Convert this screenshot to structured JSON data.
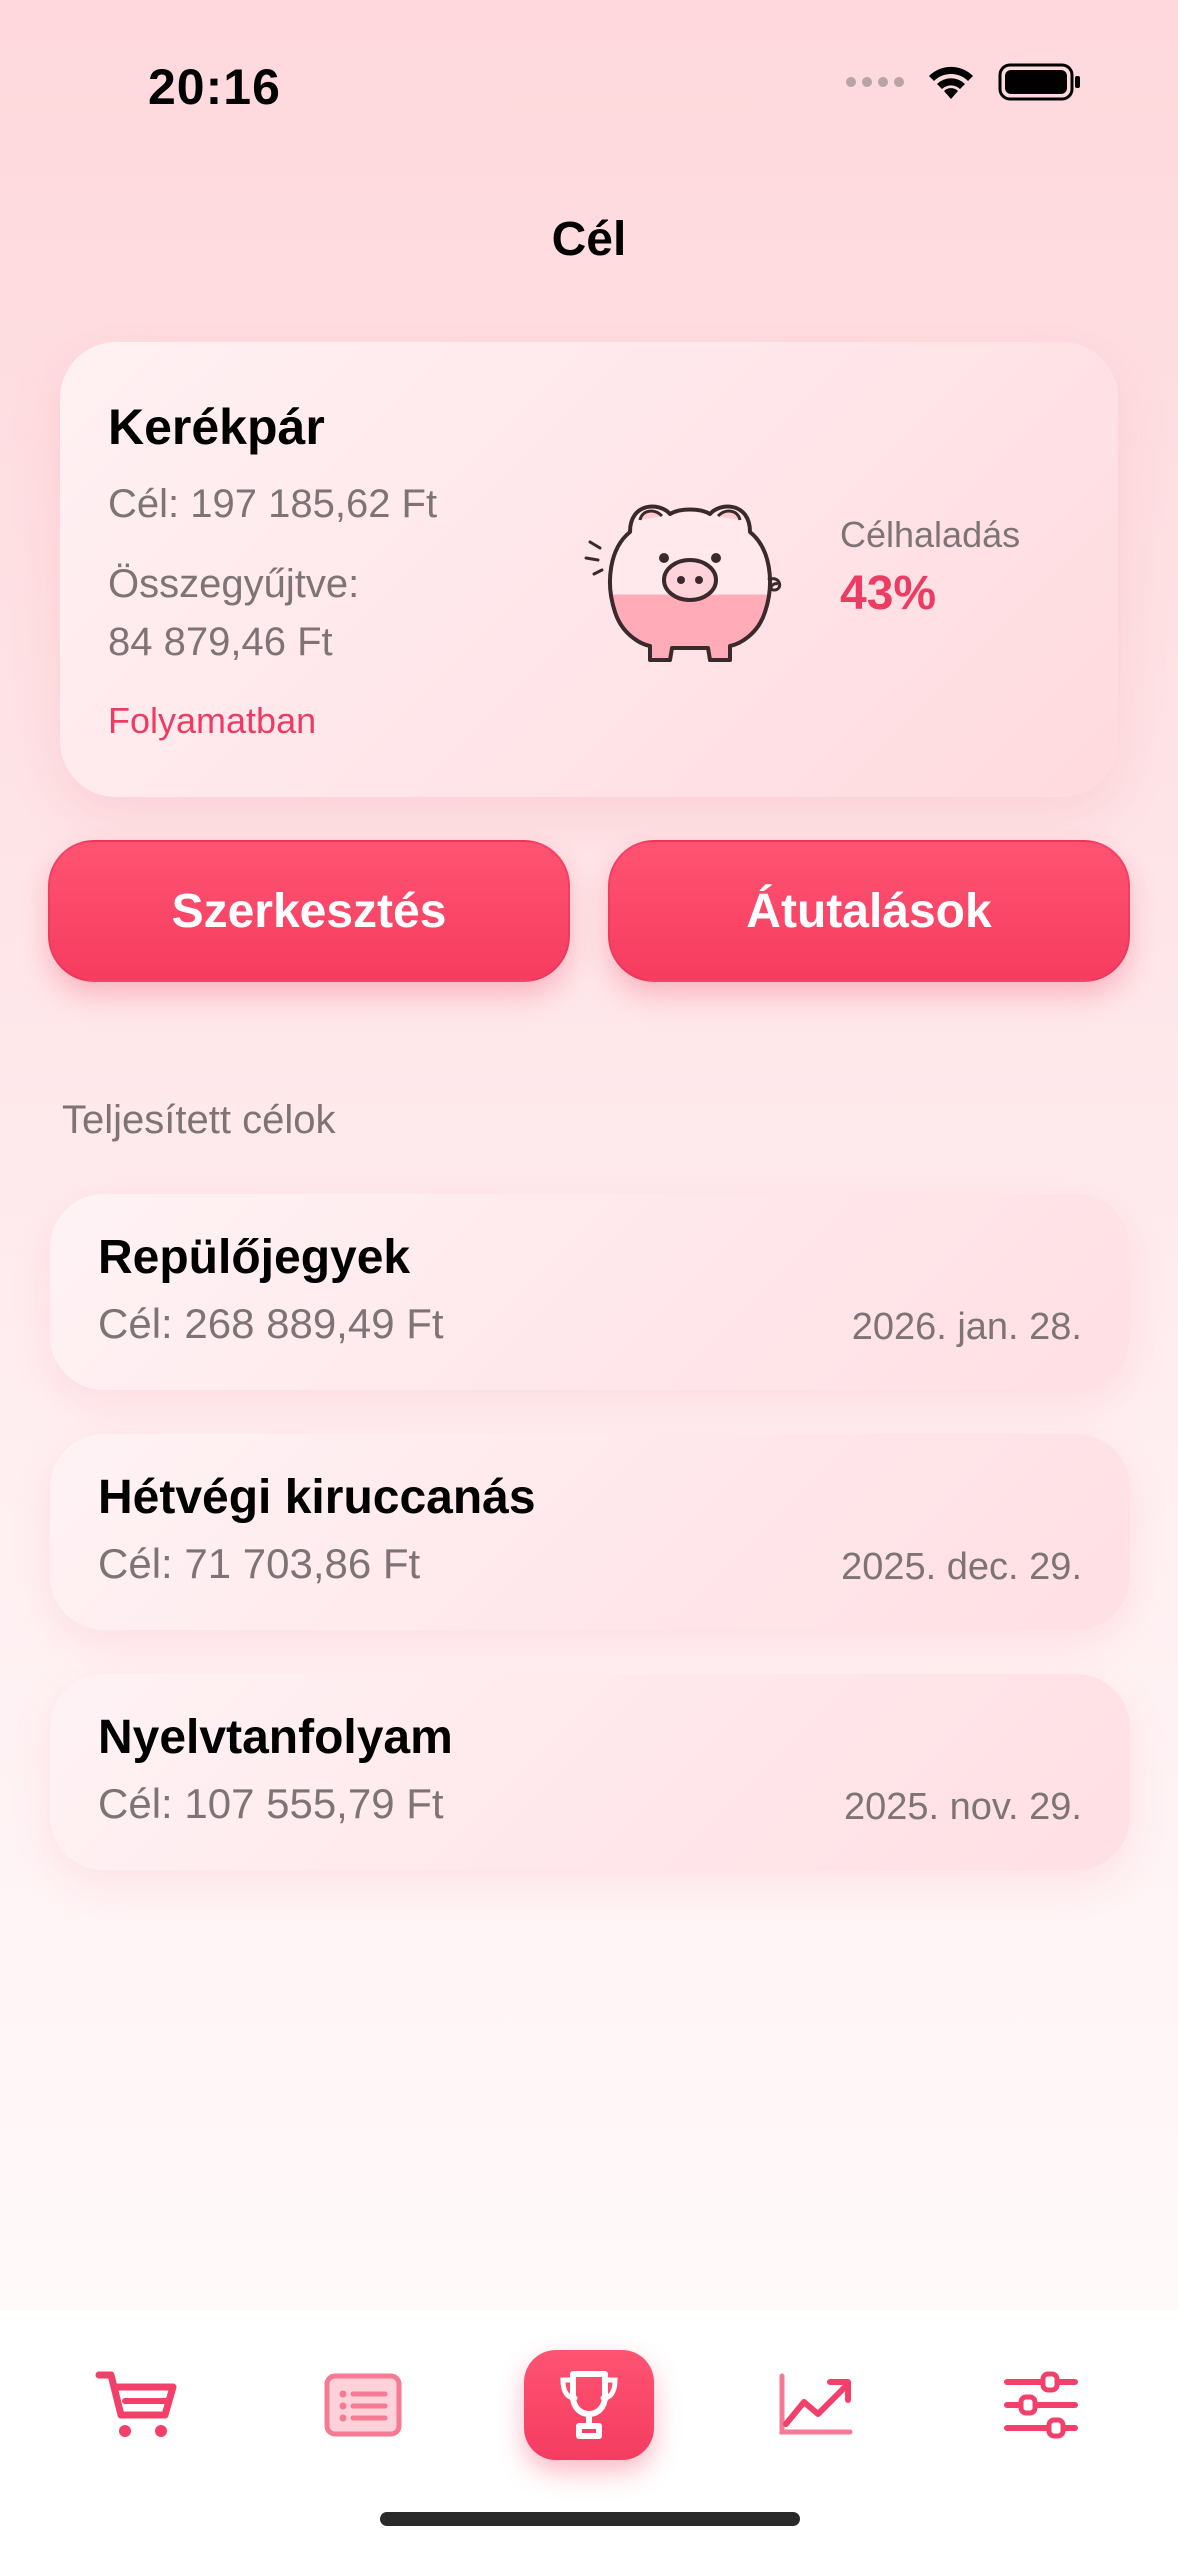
{
  "status_bar": {
    "time": "20:16"
  },
  "nav": {
    "title": "Cél"
  },
  "goal": {
    "name": "Kerékpár",
    "target": "Cél: 197 185,62 Ft",
    "collected_label": "Összegyűjtve:",
    "collected_value": "84 879,46 Ft",
    "status": "Folyamatban",
    "progress_label": "Célhaladás",
    "progress_value": "43%",
    "progress_fraction": 0.43
  },
  "actions": {
    "edit_label": "Szerkesztés",
    "transfers_label": "Átutalások"
  },
  "completed": {
    "header": "Teljesített célok",
    "items": [
      {
        "name": "Repülőjegyek",
        "target": "Cél: 268 889,49 Ft",
        "date": "2026. jan. 28."
      },
      {
        "name": "Hétvégi kiruccanás",
        "target": "Cél: 71 703,86 Ft",
        "date": "2025. dec. 29."
      },
      {
        "name": "Nyelvtanfolyam",
        "target": "Cél: 107 555,79 Ft",
        "date": "2025. nov. 29."
      }
    ]
  },
  "tab_bar": {
    "tabs": [
      {
        "icon": "cart-icon",
        "active": false
      },
      {
        "icon": "list-icon",
        "active": false
      },
      {
        "icon": "trophy-icon",
        "active": true
      },
      {
        "icon": "chart-trend-icon",
        "active": false
      },
      {
        "icon": "sliders-icon",
        "active": false
      }
    ]
  },
  "colors": {
    "accent": "#f63c60",
    "text_secondary": "#7e7476"
  }
}
